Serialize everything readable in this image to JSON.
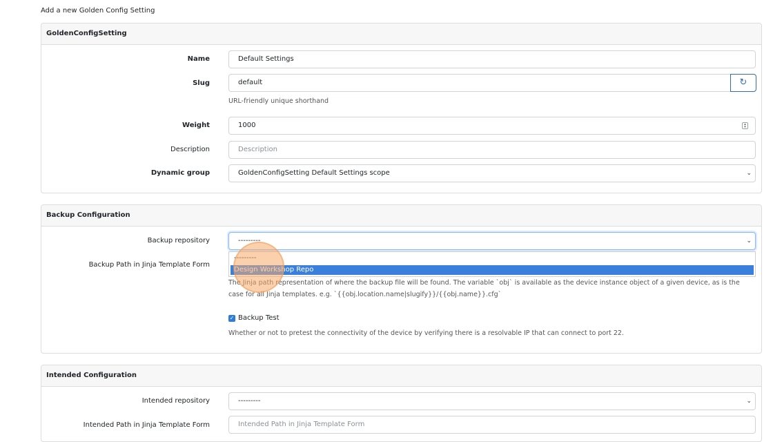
{
  "page_title": "Add a new Golden Config Setting",
  "golden_config_setting": {
    "heading": "GoldenConfigSetting",
    "name": {
      "label": "Name",
      "value": "Default Settings"
    },
    "slug": {
      "label": "Slug",
      "value": "default",
      "help": "URL-friendly unique shorthand",
      "refresh_icon": "refresh-icon"
    },
    "weight": {
      "label": "Weight",
      "value": "1000"
    },
    "description": {
      "label": "Description",
      "placeholder": "Description"
    },
    "dynamic_group": {
      "label": "Dynamic group",
      "value": "GoldenConfigSetting Default Settings scope"
    }
  },
  "backup_configuration": {
    "heading": "Backup Configuration",
    "backup_repository": {
      "label": "Backup repository",
      "value": "---------",
      "options": [
        "---------",
        "Design Workshop Repo"
      ],
      "highlighted_option": "Design Workshop Repo"
    },
    "backup_path": {
      "label": "Backup Path in Jinja Template Form",
      "help": "The Jinja path representation of where the backup file will be found. The variable `obj` is available as the device instance object of a given device, as is the case for all Jinja templates. e.g. `{{obj.location.name|slugify}}/{{obj.name}}.cfg`"
    },
    "backup_test": {
      "label": "Backup Test",
      "checked": true,
      "help": "Whether or not to pretest the connectivity of the device by verifying there is a resolvable IP that can connect to port 22."
    }
  },
  "intended_configuration": {
    "heading": "Intended Configuration",
    "intended_repository": {
      "label": "Intended repository",
      "value": "---------"
    },
    "intended_path": {
      "label": "Intended Path in Jinja Template Form",
      "placeholder": "Intended Path in Jinja Template Form"
    }
  },
  "colors": {
    "accent": "#2f6cb5",
    "selected_option": "#3a7fdc",
    "click_marker": "#f6aa69"
  }
}
